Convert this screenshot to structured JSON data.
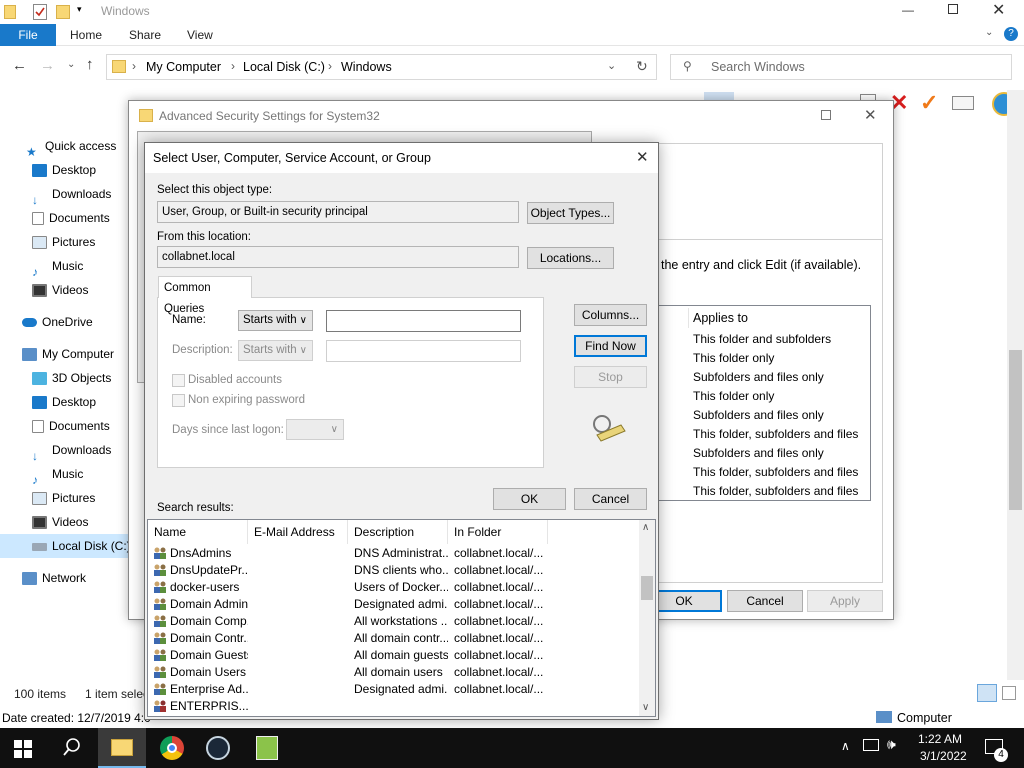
{
  "explorer": {
    "title": "Windows",
    "tabs": [
      "File",
      "Home",
      "Share",
      "View"
    ],
    "breadcrumb": [
      "My Computer",
      "Local Disk (C:)",
      "Windows"
    ],
    "search_placeholder": "Search Windows",
    "nav": [
      {
        "label": "Quick access",
        "icon": "star-icon"
      },
      {
        "label": "Desktop",
        "icon": "desktop-icon"
      },
      {
        "label": "Downloads",
        "icon": "download-icon"
      },
      {
        "label": "Documents",
        "icon": "document-icon"
      },
      {
        "label": "Pictures",
        "icon": "picture-icon"
      },
      {
        "label": "Music",
        "icon": "music-icon"
      },
      {
        "label": "Videos",
        "icon": "video-icon"
      },
      {
        "label": "OneDrive",
        "icon": "cloud-icon"
      },
      {
        "label": "My Computer",
        "icon": "computer-icon"
      },
      {
        "label": "3D Objects",
        "icon": "cube-icon"
      },
      {
        "label": "Desktop",
        "icon": "desktop-icon"
      },
      {
        "label": "Documents",
        "icon": "document-icon"
      },
      {
        "label": "Downloads",
        "icon": "download-icon"
      },
      {
        "label": "Music",
        "icon": "music-icon"
      },
      {
        "label": "Pictures",
        "icon": "picture-icon"
      },
      {
        "label": "Videos",
        "icon": "video-icon"
      },
      {
        "label": "Local Disk (C:)",
        "icon": "drive-icon"
      },
      {
        "label": "Network",
        "icon": "network-icon"
      }
    ],
    "status_items": "100 items",
    "status_selected": "1 item selec",
    "date_created": "Date created: 12/7/2019 4:0",
    "details_computer": "Computer"
  },
  "advanced": {
    "title": "Advanced Security Settings for System32",
    "instruction": "the entry and click Edit (if available).",
    "applies_header": "Applies to",
    "applies_to": [
      "This folder and subfolders",
      "This folder only",
      "Subfolders and files only",
      "This folder only",
      "Subfolders and files only",
      "This folder, subfolders and files",
      "Subfolders and files only",
      "This folder, subfolders and files",
      "This folder, subfolders and files"
    ],
    "ok": "OK",
    "cancel": "Cancel",
    "apply": "Apply"
  },
  "select_dialog": {
    "title": "Select User, Computer, Service Account, or Group",
    "object_type_label": "Select this object type:",
    "object_type_value": "User, Group, or Built-in security principal",
    "object_types_button": "Object Types...",
    "location_label": "From this location:",
    "location_value": "collabnet.local",
    "locations_button": "Locations...",
    "common_queries_tab": "Common Queries",
    "name_label": "Name:",
    "name_mode": "Starts with",
    "description_label": "Description:",
    "description_mode": "Starts with",
    "disabled_accounts": "Disabled accounts",
    "non_expiring": "Non expiring password",
    "days_since": "Days since last logon:",
    "columns_button": "Columns...",
    "find_now_button": "Find Now",
    "stop_button": "Stop",
    "ok_button": "OK",
    "cancel_button": "Cancel",
    "search_results_label": "Search results:",
    "columns": [
      "Name",
      "E-Mail Address",
      "Description",
      "In Folder"
    ],
    "rows": [
      {
        "name": "DnsAdmins",
        "email": "",
        "description": "DNS Administrat...",
        "folder": "collabnet.local/..."
      },
      {
        "name": "DnsUpdatePr...",
        "email": "",
        "description": "DNS clients who...",
        "folder": "collabnet.local/..."
      },
      {
        "name": "docker-users",
        "email": "",
        "description": "Users of Docker...",
        "folder": "collabnet.local/..."
      },
      {
        "name": "Domain Admins",
        "email": "",
        "description": "Designated admi...",
        "folder": "collabnet.local/..."
      },
      {
        "name": "Domain Comp...",
        "email": "",
        "description": "All workstations ...",
        "folder": "collabnet.local/..."
      },
      {
        "name": "Domain Contr...",
        "email": "",
        "description": "All domain contr...",
        "folder": "collabnet.local/..."
      },
      {
        "name": "Domain Guests",
        "email": "",
        "description": "All domain guests",
        "folder": "collabnet.local/..."
      },
      {
        "name": "Domain Users",
        "email": "",
        "description": "All domain users",
        "folder": "collabnet.local/..."
      },
      {
        "name": "Enterprise Ad...",
        "email": "",
        "description": "Designated admi...",
        "folder": "collabnet.local/..."
      },
      {
        "name": "ENTERPRIS...",
        "email": "",
        "description": "",
        "folder": ""
      }
    ]
  },
  "taskbar": {
    "time": "1:22 AM",
    "date": "3/1/2022",
    "notification_count": "4"
  },
  "colors": {
    "accent": "#0078d7",
    "file_tab": "#1979ca",
    "taskbar": "#101010"
  }
}
